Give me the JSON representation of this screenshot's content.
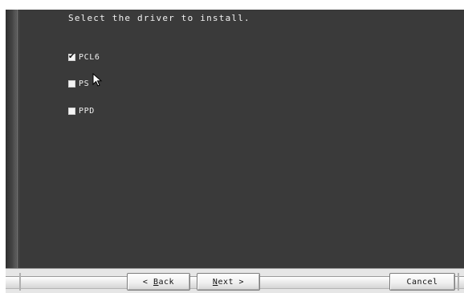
{
  "instruction": "Select the driver to install.",
  "options": [
    {
      "label": "PCL6",
      "checked": true
    },
    {
      "label": "PS",
      "checked": false
    },
    {
      "label": "PPD",
      "checked": false
    }
  ],
  "buttons": {
    "back": {
      "prefix": "< ",
      "mnemonic": "B",
      "rest": "ack"
    },
    "next": {
      "mnemonic": "N",
      "rest": "ext",
      "suffix": " >"
    },
    "cancel": "Cancel"
  },
  "colors": {
    "background": "#3a3a3a",
    "text": "#f2f2f2",
    "button_bar": "#e6e6e6"
  }
}
